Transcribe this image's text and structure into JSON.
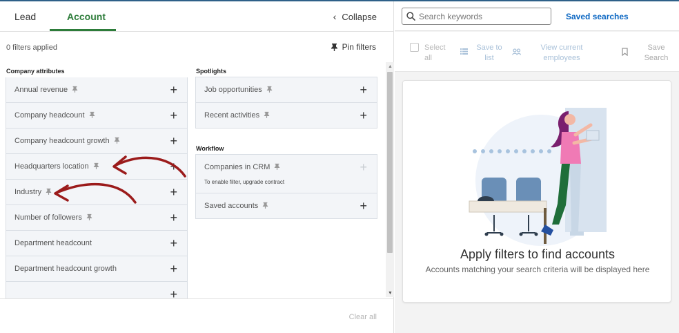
{
  "tabs": {
    "lead": "Lead",
    "account": "Account",
    "collapse": "Collapse"
  },
  "filters": {
    "applied_text": "0 filters applied",
    "pin_filters": "Pin filters",
    "clear_all": "Clear all"
  },
  "company_attributes": {
    "title": "Company attributes",
    "items": [
      {
        "label": "Annual revenue",
        "pinned_icon": true
      },
      {
        "label": "Company headcount",
        "pinned_icon": true
      },
      {
        "label": "Company headcount growth",
        "pinned_icon": true
      },
      {
        "label": "Headquarters location",
        "pinned_icon": true
      },
      {
        "label": "Industry",
        "pinned_icon": true
      },
      {
        "label": "Number of followers",
        "pinned_icon": true
      },
      {
        "label": "Department headcount",
        "pinned_icon": false
      },
      {
        "label": "Department headcount growth",
        "pinned_icon": false
      }
    ]
  },
  "spotlights": {
    "title": "Spotlights",
    "items": [
      {
        "label": "Job opportunities"
      },
      {
        "label": "Recent activities"
      }
    ]
  },
  "workflow": {
    "title": "Workflow",
    "items": [
      {
        "label": "Companies in CRM",
        "note": "To enable filter, upgrade contract",
        "disabled": true
      },
      {
        "label": "Saved accounts"
      }
    ]
  },
  "search": {
    "placeholder": "Search keywords",
    "saved_searches": "Saved searches"
  },
  "toolbar": {
    "select_all": "Select all",
    "save_to_list": "Save to list",
    "view_current_employees": "View current employees",
    "save_search": "Save Search"
  },
  "empty_state": {
    "title": "Apply filters to find accounts",
    "subtitle": "Accounts matching your search criteria will be displayed here"
  },
  "colors": {
    "accent_green": "#2d7c3a",
    "link_blue": "#0a66c2",
    "annotation_red": "#9b1b1b"
  }
}
